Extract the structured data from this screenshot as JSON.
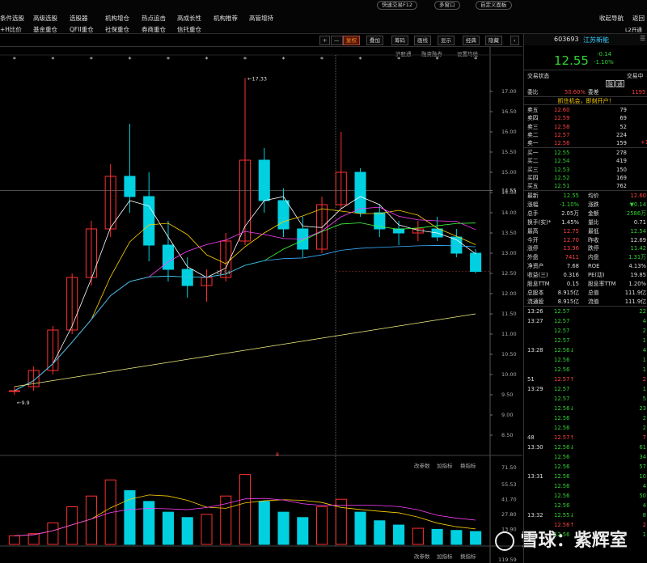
{
  "top_nav": {
    "row1": [
      "条件选股",
      "高级选股",
      "选股器",
      "机构增仓",
      "热点追击",
      "高成长性",
      "机构推荐",
      "高管增持"
    ],
    "row2": [
      "+H比价",
      "基金重仓",
      "QFII重仓",
      "社保重仓",
      "券商重仓",
      "信托重仓"
    ],
    "buttons": {
      "quick_trade": "快速交易F12",
      "multi_window": "多窗口",
      "custom_panel": "自定义面板"
    },
    "right_row1": [
      "收起导航",
      "返回"
    ],
    "right_row2": "L2开通"
  },
  "chart_toolbar": {
    "plus": "+",
    "minus": "—",
    "items": [
      "复权",
      "叠加",
      "筹码",
      "画线",
      "显示",
      "经典",
      "隐藏"
    ],
    "active": "复权"
  },
  "chart_subtabs": [
    "沪股通",
    "融资融券",
    "设置均线"
  ],
  "main_chart": {
    "price_axis": [
      "17.00",
      "16.50",
      "16.00",
      "15.50",
      "15.00",
      "14.55",
      "14.50",
      "14.00",
      "13.50",
      "13.00",
      "12.50",
      "12.00",
      "11.50",
      "11.00",
      "10.50",
      "10.00",
      "9.50",
      "9.00",
      "8.50"
    ],
    "high_label": "←17.33",
    "low_label": "←9.9",
    "current_label": "12.54",
    "mid_marker": "8"
  },
  "volume_chart": {
    "axis": [
      "71.50",
      "55.53",
      "41.70",
      "27.80",
      "13.90"
    ],
    "bottom_value": "119.59",
    "controls": [
      "改参数",
      "加指标",
      "换指标"
    ]
  },
  "chart_data": [
    {
      "type": "candlestick",
      "title": "",
      "note": "Daily K-line with moving averages; values approximate",
      "ylim": [
        8.5,
        17.5
      ],
      "candles": [
        [
          9.6,
          9.7,
          9.5,
          9.6
        ],
        [
          9.7,
          10.2,
          9.6,
          10.1
        ],
        [
          10.1,
          11.2,
          10.0,
          11.1
        ],
        [
          11.1,
          12.5,
          11.0,
          12.4
        ],
        [
          12.4,
          13.8,
          12.2,
          13.6
        ],
        [
          13.6,
          15.2,
          13.4,
          14.9
        ],
        [
          14.9,
          16.2,
          14.0,
          14.4
        ],
        [
          14.4,
          15.0,
          12.8,
          13.2
        ],
        [
          13.2,
          13.8,
          12.3,
          12.6
        ],
        [
          12.6,
          12.9,
          11.9,
          12.2
        ],
        [
          12.2,
          12.6,
          11.8,
          12.4
        ],
        [
          12.4,
          13.5,
          12.3,
          13.3
        ],
        [
          13.3,
          17.33,
          13.2,
          15.3
        ],
        [
          15.3,
          15.6,
          14.0,
          14.3
        ],
        [
          14.3,
          14.6,
          13.4,
          13.6
        ],
        [
          13.6,
          13.9,
          12.9,
          13.1
        ],
        [
          13.1,
          14.4,
          13.0,
          14.2
        ],
        [
          14.2,
          16.0,
          14.1,
          15.0
        ],
        [
          15.0,
          15.1,
          13.9,
          14.0
        ],
        [
          14.0,
          14.2,
          13.4,
          13.6
        ],
        [
          13.6,
          13.8,
          13.2,
          13.5
        ],
        [
          13.5,
          13.8,
          13.3,
          13.6
        ],
        [
          13.6,
          13.9,
          13.3,
          13.4
        ],
        [
          13.4,
          13.6,
          12.9,
          13.0
        ],
        [
          13.0,
          13.1,
          12.5,
          12.55
        ]
      ],
      "series": [
        {
          "name": "MA5"
        },
        {
          "name": "MA10"
        },
        {
          "name": "MA20"
        },
        {
          "name": "MA60"
        },
        {
          "name": "MA120"
        }
      ]
    },
    {
      "type": "bar",
      "title": "",
      "note": "Volume (approximate)",
      "ylim": [
        0,
        71.5
      ],
      "values": [
        8,
        10,
        20,
        35,
        45,
        60,
        50,
        40,
        30,
        25,
        28,
        45,
        65,
        40,
        30,
        25,
        35,
        42,
        30,
        22,
        18,
        15,
        14,
        13,
        12
      ]
    }
  ],
  "right_panel": {
    "code": "603693",
    "name": "江苏新能",
    "price": "12.55",
    "change": "-0.14",
    "change_pct": "-1.10%",
    "status_label": "交易状态",
    "status_value": "交易中",
    "rz": "融",
    "tong": "通",
    "weibi_label": "委比",
    "weibi": "50.60%",
    "weicha_label": "委差",
    "weicha": "1195",
    "promo": "抓住机会，即刻开户！",
    "asks": [
      [
        "卖五",
        "12.60",
        "79"
      ],
      [
        "卖四",
        "12.59",
        "69"
      ],
      [
        "卖三",
        "12.58",
        "52"
      ],
      [
        "卖二",
        "12.57",
        "224"
      ],
      [
        "卖一",
        "12.56",
        "159"
      ]
    ],
    "ask1_extra": "+1",
    "bids": [
      [
        "买一",
        "12.55",
        "278"
      ],
      [
        "买二",
        "12.54",
        "419"
      ],
      [
        "买三",
        "12.53",
        "150"
      ],
      [
        "买四",
        "12.52",
        "169"
      ],
      [
        "买五",
        "12.51",
        "762"
      ]
    ],
    "stats": [
      [
        "最新",
        "12.55",
        "均价",
        "12.60"
      ],
      [
        "涨幅",
        "-1.10%",
        "涨跌",
        "▼0.14"
      ],
      [
        "总手",
        "2.05万",
        "金额",
        "2586万"
      ],
      [
        "换手(实)*",
        "1.45%",
        "量比",
        "0.71"
      ],
      [
        "最高",
        "12.75",
        "最低",
        "12.54"
      ],
      [
        "今开",
        "12.70",
        "昨收",
        "12.69"
      ],
      [
        "涨停",
        "13.96",
        "跌停",
        "11.42"
      ],
      [
        "外盘",
        "7411",
        "内盘",
        "1.31万"
      ],
      [
        "净资产",
        "7.68",
        "ROE",
        "4.13%"
      ],
      [
        "收益(三)",
        "0.316",
        "PE(动)",
        "19.85"
      ],
      [
        "股息TTM",
        "0.15",
        "股息率TTM",
        "1.20%"
      ],
      [
        "总股本",
        "8.915亿",
        "总值",
        "111.9亿"
      ],
      [
        "流通股",
        "8.915亿",
        "流值",
        "111.9亿"
      ]
    ],
    "ticks": [
      [
        "13:26",
        "12.57",
        "22"
      ],
      [
        "13:27",
        "12.57",
        "4"
      ],
      [
        "",
        "12.57",
        "2"
      ],
      [
        "",
        "12.57",
        "1"
      ],
      [
        "13:28",
        "12.56↓",
        "4"
      ],
      [
        "",
        "12.56",
        "1"
      ],
      [
        "",
        "12.56",
        "1"
      ],
      [
        "51",
        "12.57↑",
        "2"
      ],
      [
        "13:29",
        "12.57",
        "1"
      ],
      [
        "",
        "12.57",
        "5"
      ],
      [
        "",
        "12.56↓",
        "23"
      ],
      [
        "",
        "12.56",
        "2"
      ],
      [
        "",
        "12.56",
        "2"
      ],
      [
        "48",
        "12.57↑",
        "7"
      ],
      [
        "13:30",
        "12.56↓",
        "61"
      ],
      [
        "",
        "12.56",
        "34"
      ],
      [
        "",
        "12.56",
        "57"
      ],
      [
        "13:31",
        "12.56",
        "10"
      ],
      [
        "",
        "12.56",
        "4"
      ],
      [
        "",
        "12.56",
        "50"
      ],
      [
        "",
        "12.56",
        "4"
      ],
      [
        "13:32",
        "12.55↓",
        "8"
      ],
      [
        "",
        "12.56↑",
        "2"
      ],
      [
        "",
        "12.56",
        "1"
      ]
    ]
  },
  "watermark": {
    "brand": "雪球",
    "author": "紫辉室"
  }
}
